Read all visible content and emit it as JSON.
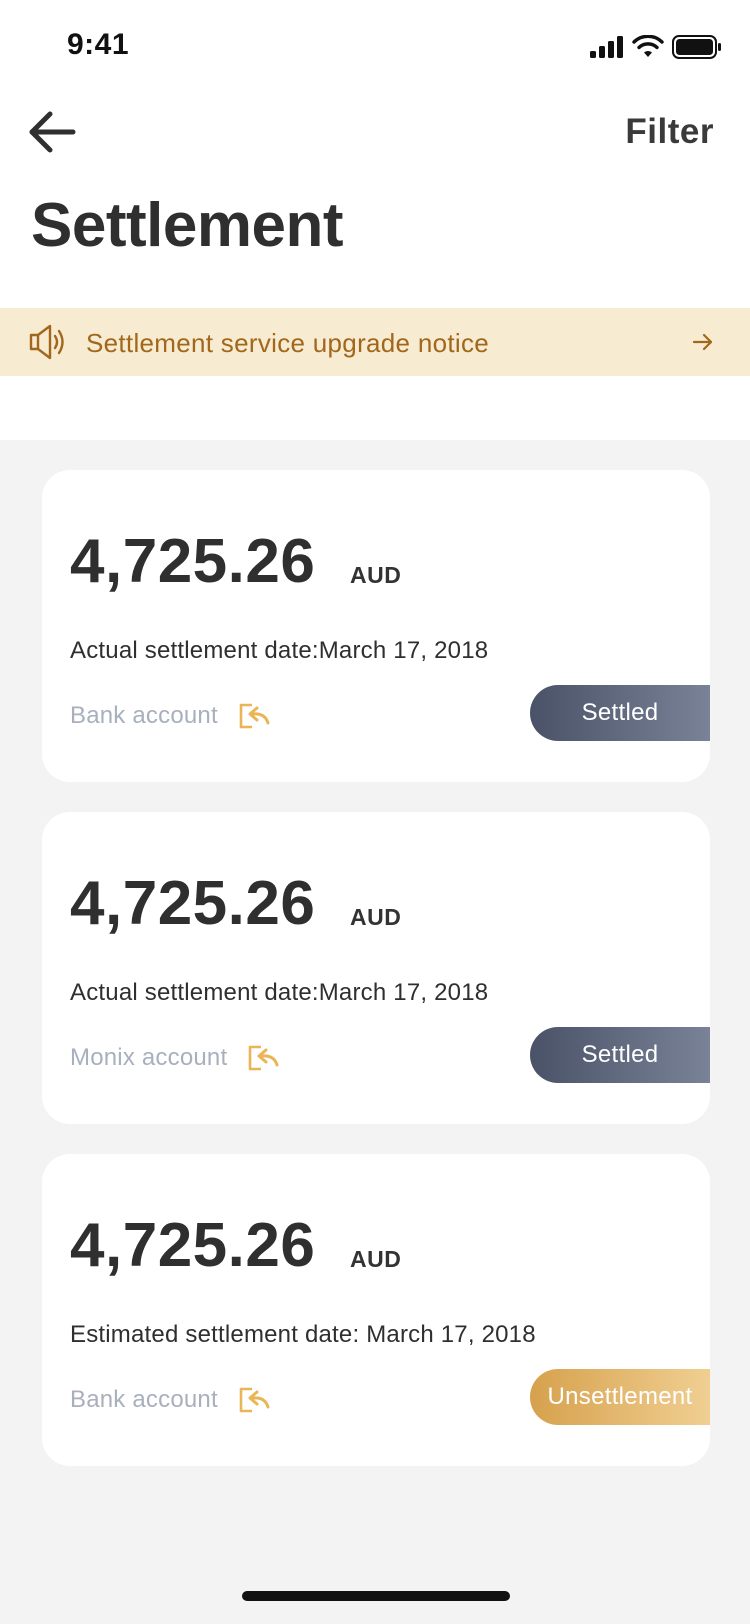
{
  "status_bar": {
    "time": "9:41"
  },
  "header": {
    "filter_label": "Filter",
    "title": "Settlement"
  },
  "notice": {
    "text": "Settlement service upgrade notice"
  },
  "records": [
    {
      "amount": "4,725.26",
      "currency": "AUD",
      "date_text": "Actual settlement date:March 17, 2018",
      "account": "Bank account",
      "status": "Settled"
    },
    {
      "amount": "4,725.26",
      "currency": "AUD",
      "date_text": "Actual settlement date:March 17, 2018",
      "account": "Monix account",
      "status": "Settled"
    },
    {
      "amount": "4,725.26",
      "currency": "AUD",
      "date_text": "Estimated settlement date: March 17, 2018",
      "account": "Bank account",
      "status": "Unsettlement"
    }
  ],
  "colors": {
    "notice_bg": "#f7ebd2",
    "notice_text": "#a2671a",
    "settled_pill": "#4a5268",
    "unsettled_pill": "#d6a14d",
    "account_icon": "#e9b556"
  },
  "icons": {
    "back": "arrow-left-icon",
    "notice": "speaker-icon",
    "notice_go": "arrow-right-icon",
    "account": "transfer-icon"
  }
}
